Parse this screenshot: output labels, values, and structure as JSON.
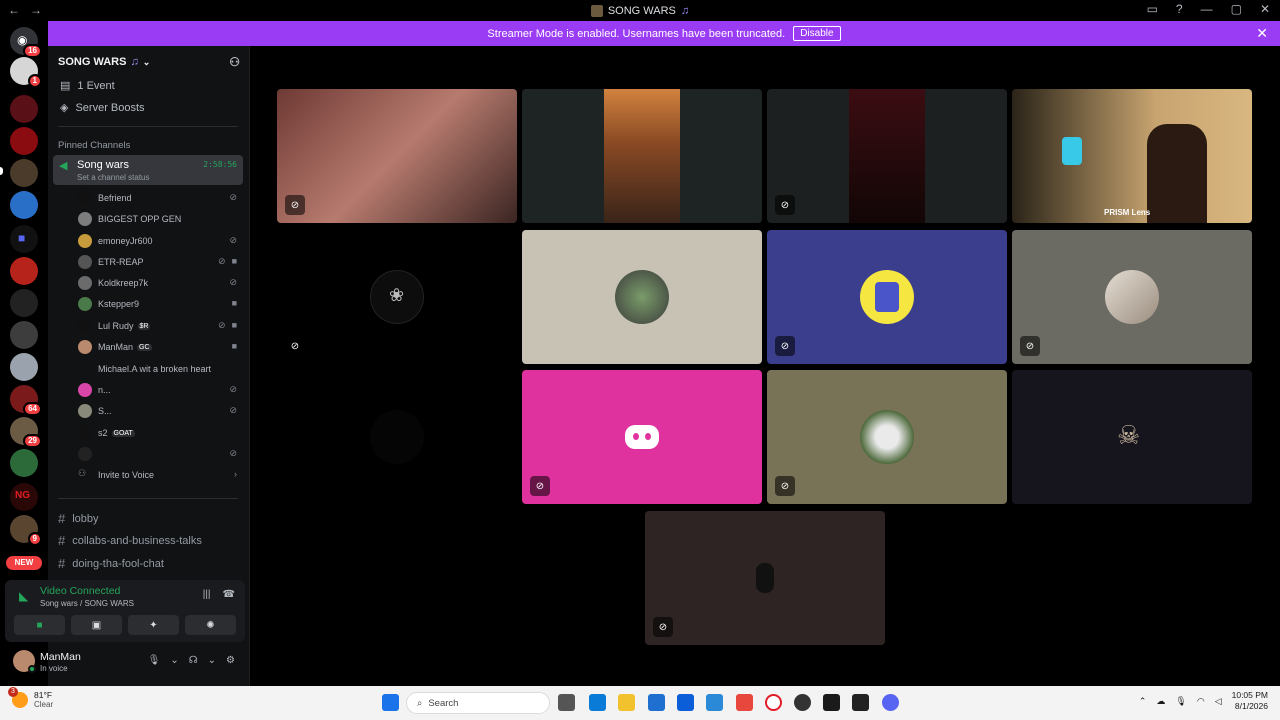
{
  "window": {
    "title": "SONG WARS",
    "back": "←",
    "forward": "→"
  },
  "banner": {
    "text": "Streamer Mode is enabled. Usernames have been truncated.",
    "disable_label": "Disable",
    "close": "✕"
  },
  "rail": {
    "badges": [
      "16",
      "1",
      "64",
      "29",
      "9"
    ],
    "new_label": "NEW"
  },
  "server": {
    "name": "SONG WARS",
    "events_label": "1 Event",
    "boosts_label": "Server Boosts",
    "pinned_label": "Pinned Channels"
  },
  "voice_channel": {
    "name": "Song wars",
    "status": "Set a channel status",
    "timer": "2:58:56"
  },
  "members": [
    {
      "name": "Befriend",
      "tag": ""
    },
    {
      "name": "BIGGEST OPP GEN",
      "tag": ""
    },
    {
      "name": "emoneyJr600",
      "tag": ""
    },
    {
      "name": "ETR-REAP",
      "tag": ""
    },
    {
      "name": "Koldkreep7k",
      "tag": ""
    },
    {
      "name": "Kstepper9",
      "tag": ""
    },
    {
      "name": "Lul Rudy",
      "tag": "$R"
    },
    {
      "name": "ManMan",
      "tag": "GC"
    },
    {
      "name": "Michael.A wit a broken heart",
      "tag": ""
    },
    {
      "name": "n...",
      "tag": ""
    },
    {
      "name": "S...",
      "tag": ""
    },
    {
      "name": "s2",
      "tag": "GOAT"
    },
    {
      "name": "",
      "tag": ""
    }
  ],
  "invite_label": "Invite to Voice",
  "text_channels": [
    "lobby",
    "collabs-and-business-talks",
    "doing-tha-fool-chat"
  ],
  "voice_panel": {
    "title": "Video Connected",
    "subtitle": "Song wars / SONG WARS"
  },
  "user": {
    "name": "ManMan",
    "status": "In voice"
  },
  "video_overlay": {
    "prism_label": "PRISM Lens"
  },
  "taskbar": {
    "temp": "81°F",
    "condition": "Clear",
    "weather_badge": "3",
    "search_placeholder": "Search",
    "time": "10:05 PM",
    "date": "8/1/2026"
  },
  "colors": {
    "banner": "#9b3cf5",
    "connected": "#23a55a",
    "discord_tile": "#e0329e",
    "blurple_tile": "#3b3e8c"
  }
}
